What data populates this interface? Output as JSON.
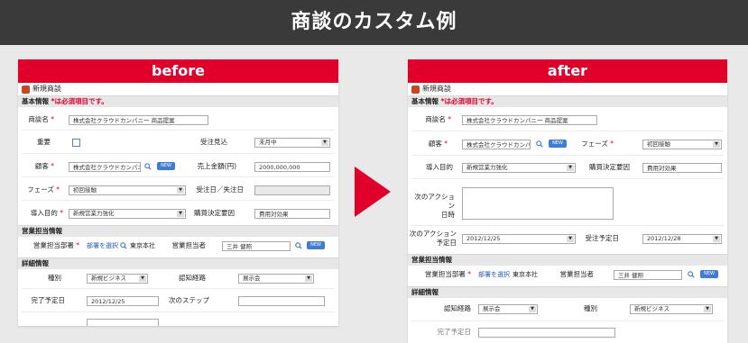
{
  "banner": {
    "title": "商談のカスタム例"
  },
  "before": {
    "header": "before",
    "app_title": "新規商談",
    "sections": {
      "basic": "基本情報",
      "basic_note": "*は必須項目です。",
      "sales": "営業担当情報",
      "detail": "詳細情報"
    },
    "fields": {
      "deal_name_label": "商談名",
      "deal_name_value": "株式会社クラウドカンパニー 商品提案",
      "important_label": "重要",
      "order_forecast_label": "受注見込",
      "order_forecast_value": "未月中",
      "customer_label": "顧客",
      "customer_value": "株式会社クラウドカンパニー",
      "customer_btn": "NEW",
      "sales_amount_label": "売上金額(円)",
      "sales_amount_value": "2000,000,000",
      "phase_label": "フェーズ",
      "phase_value": "初回接触",
      "order_date_label": "受注日／失注日",
      "purpose_label": "導入目的",
      "purpose_value": "新規営業力強化",
      "purchase_factor_label": "購買決定要因",
      "purchase_factor_value": "費用対効果",
      "sales_dept_label": "営業担当部署",
      "sales_dept_link": "部署を選択",
      "sales_dept_value": "東京本社",
      "sales_person_label": "営業担当者",
      "sales_person_value": "三井 健照",
      "sales_person_btn": "NEW",
      "type_label": "種別",
      "type_value": "新規ビジネス",
      "route_label": "認知経路",
      "route_value": "展示会",
      "complete_date_label": "完了予定日",
      "complete_date_value": "2012/12/25",
      "next_step_label": "次のステップ"
    }
  },
  "after": {
    "header": "after",
    "app_title": "新規商談",
    "sections": {
      "basic": "基本情報",
      "basic_note": "*は必須項目です。",
      "sales": "営業担当情報",
      "detail": "詳細情報"
    },
    "fields": {
      "deal_name_label": "商談名",
      "deal_name_value": "株式会社クラウドカンパニー 商品提案",
      "customer_label": "顧客",
      "customer_value": "株式会社クラウドカンパニー",
      "customer_btn": "NEW",
      "phase_label": "フェーズ",
      "phase_value": "初回接触",
      "purpose_label": "導入目的",
      "purpose_value": "新規営業力強化",
      "purchase_factor_label": "購買決定要因",
      "purchase_factor_value": "費用対効果",
      "next_action_label": "次のアクション\n日時",
      "next_action_date_label": "次のアクション\n予定日",
      "next_action_date_value": "2012/12/25",
      "order_plan_label": "受注予定日",
      "order_plan_value": "2012/12/28",
      "sales_dept_label": "営業担当部署",
      "sales_dept_link": "部署を選択",
      "sales_dept_value": "東京本社",
      "sales_person_label": "営業担当者",
      "sales_person_value": "三井 健照",
      "sales_person_btn": "NEW",
      "route_label": "認知経路",
      "route_value": "展示会",
      "type_label": "種別",
      "type_value": "新規ビジネス",
      "remaining_label": "完了予定日"
    }
  }
}
